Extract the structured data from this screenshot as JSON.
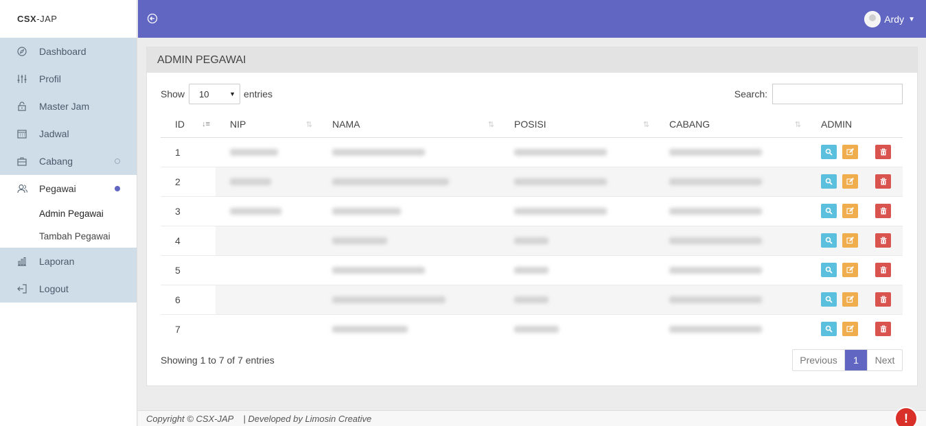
{
  "brand": {
    "bold": "CSX",
    "rest": "-JAP"
  },
  "sidebar": {
    "items": [
      {
        "label": "Dashboard",
        "icon": "compass-icon"
      },
      {
        "label": "Profil",
        "icon": "sliders-icon"
      },
      {
        "label": "Master Jam",
        "icon": "lock-icon"
      },
      {
        "label": "Jadwal",
        "icon": "calendar-icon"
      },
      {
        "label": "Cabang",
        "icon": "briefcase-icon"
      },
      {
        "label": "Pegawai",
        "icon": "users-icon"
      },
      {
        "label": "Laporan",
        "icon": "bar-chart-icon"
      },
      {
        "label": "Logout",
        "icon": "logout-icon"
      }
    ],
    "subitems": [
      {
        "label": "Admin Pegawai"
      },
      {
        "label": "Tambah Pegawai"
      }
    ]
  },
  "topbar": {
    "username": "Ardy"
  },
  "panel": {
    "title": "ADMIN PEGAWAI"
  },
  "table_controls": {
    "show_label": "Show",
    "entries_value": "10",
    "entries_label": "entries",
    "search_label": "Search:"
  },
  "table": {
    "columns": [
      "ID",
      "NIP",
      "NAMA",
      "POSISI",
      "CABANG",
      "ADMIN"
    ],
    "rows": [
      {
        "id": "1"
      },
      {
        "id": "2"
      },
      {
        "id": "3"
      },
      {
        "id": "4"
      },
      {
        "id": "5"
      },
      {
        "id": "6"
      },
      {
        "id": "7"
      }
    ]
  },
  "table_info": "Showing 1 to 7 of 7 entries",
  "pagination": {
    "previous": "Previous",
    "page": "1",
    "next": "Next"
  },
  "footer": {
    "copyright": "Copyright © CSX-JAP",
    "developed": "| Developed by Limosin Creative"
  },
  "alert_badge": "!",
  "colors": {
    "accent": "#6066c2",
    "sidebar": "#cfdde9",
    "view": "#5bc0de",
    "edit": "#f0ad4e",
    "delete": "#d9534f"
  }
}
